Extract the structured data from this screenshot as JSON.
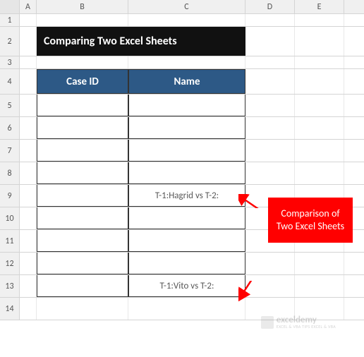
{
  "columns": [
    "A",
    "B",
    "C",
    "D",
    "E"
  ],
  "rows": [
    "1",
    "2",
    "3",
    "4",
    "5",
    "6",
    "7",
    "8",
    "9",
    "10",
    "11",
    "12",
    "13",
    "14"
  ],
  "title": "Comparing Two Excel Sheets",
  "headers": {
    "col_b": "Case ID",
    "col_c": "Name"
  },
  "data": {
    "r5": {
      "b": "",
      "c": ""
    },
    "r6": {
      "b": "",
      "c": ""
    },
    "r7": {
      "b": "",
      "c": ""
    },
    "r8": {
      "b": "",
      "c": ""
    },
    "r9": {
      "b": "",
      "c": "T-1:Hagrid vs T-2:"
    },
    "r10": {
      "b": "",
      "c": ""
    },
    "r11": {
      "b": "",
      "c": ""
    },
    "r12": {
      "b": "",
      "c": ""
    },
    "r13": {
      "b": "",
      "c": "T-1:Vito vs T-2:"
    }
  },
  "callout": "Comparison of Two Excel Sheets",
  "watermark": {
    "brand": "exceldemy",
    "tagline": "EXCEL & VBA TIPS EXCEL & VBA"
  }
}
